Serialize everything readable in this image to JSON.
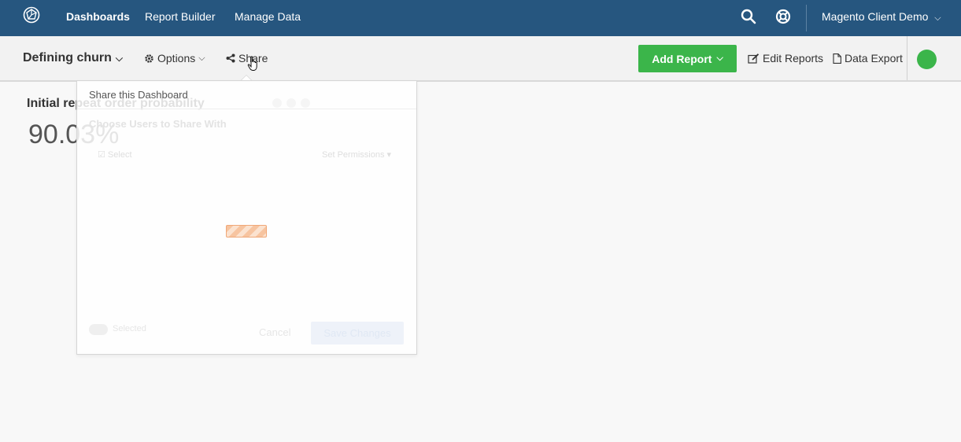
{
  "nav": {
    "items": [
      {
        "label": "Dashboards",
        "active": true
      },
      {
        "label": "Report Builder",
        "active": false
      },
      {
        "label": "Manage Data",
        "active": false
      }
    ],
    "client_label": "Magento Client Demo",
    "icons": [
      "search-icon",
      "help-lifebuoy-icon",
      "chevron-down-icon"
    ]
  },
  "toolbar": {
    "dashboard_title": "Defining churn",
    "options_label": "Options",
    "share_label": "Share",
    "add_report_label": "Add Report",
    "edit_reports_label": "Edit Reports",
    "data_export_label": "Data Export",
    "status_color": "#3bb54a"
  },
  "report": {
    "title": "Initial repeat order probability",
    "value": "90.03%"
  },
  "share_popover": {
    "title": "Share this Dashboard",
    "subtitle": "Choose Users to Share With",
    "select_label": "Select",
    "permissions_label": "Set Permissions",
    "selected_label": "Selected",
    "cancel_label": "Cancel",
    "save_label": "Save Changes"
  },
  "colors": {
    "nav_bg": "#26567f",
    "accent_green": "#3bb54a",
    "loader_orange": "#f7c4a0"
  }
}
